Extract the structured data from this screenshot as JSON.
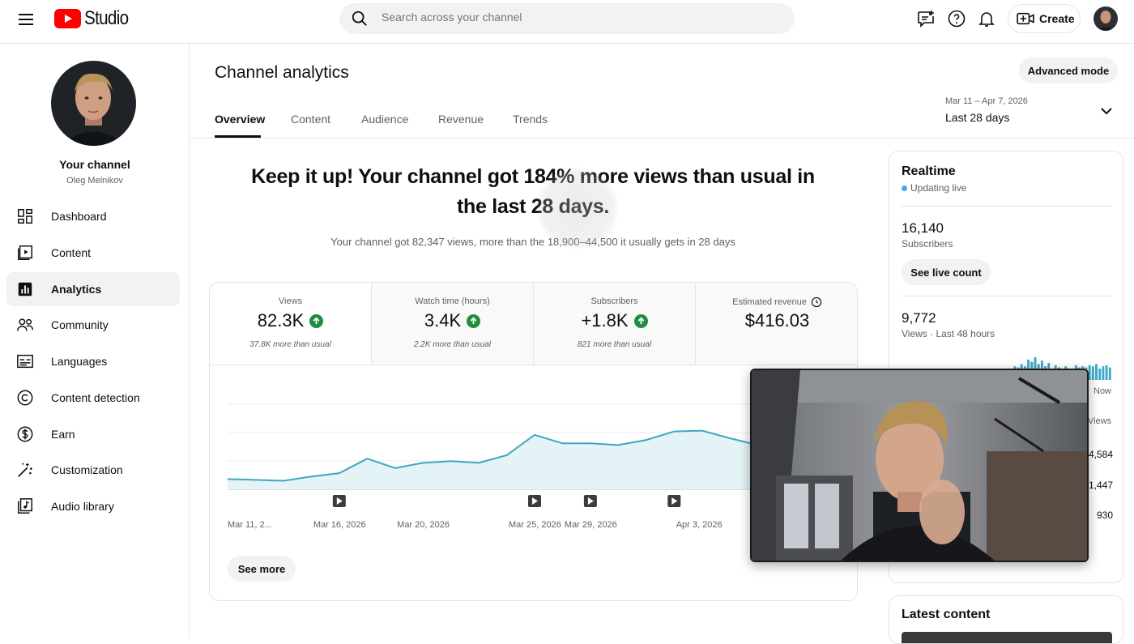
{
  "topbar": {
    "logo_text": "Studio",
    "search_placeholder": "Search across your channel",
    "create_label": "Create"
  },
  "sidebar": {
    "channel_name": "Your channel",
    "channel_handle": "Oleg Melnikov",
    "items": [
      {
        "label": "Dashboard",
        "icon": "dashboard-icon"
      },
      {
        "label": "Content",
        "icon": "content-icon"
      },
      {
        "label": "Analytics",
        "icon": "analytics-icon",
        "active": true
      },
      {
        "label": "Community",
        "icon": "community-icon"
      },
      {
        "label": "Languages",
        "icon": "languages-icon"
      },
      {
        "label": "Content detection",
        "icon": "copyright-icon"
      },
      {
        "label": "Earn",
        "icon": "dollar-icon"
      },
      {
        "label": "Customization",
        "icon": "magic-wand-icon"
      },
      {
        "label": "Audio library",
        "icon": "audio-library-icon"
      }
    ]
  },
  "main": {
    "title": "Channel analytics",
    "advanced_mode": "Advanced mode",
    "tabs": [
      "Overview",
      "Content",
      "Audience",
      "Revenue",
      "Trends"
    ],
    "active_tab": "Overview",
    "date_range": "Mar 11 – Apr 7, 2026",
    "date_label": "Last 28 days",
    "headline": "Keep it up! Your channel got 184% more views than usual in the last 28 days.",
    "subline": "Your channel got 82,347 views, more than the 18,900–44,500 it usually gets in 28 days",
    "see_more": "See more"
  },
  "metrics": [
    {
      "label": "Views",
      "value": "82.3K",
      "note": "37.8K more than usual",
      "trend": "up"
    },
    {
      "label": "Watch time (hours)",
      "value": "3.4K",
      "note": "2.2K more than usual",
      "trend": "up"
    },
    {
      "label": "Subscribers",
      "value": "+1.8K",
      "note": "821 more than usual",
      "trend": "up"
    },
    {
      "label": "Estimated revenue",
      "value": "$416.03",
      "note": "",
      "trend": "none",
      "icon": "clock-icon"
    }
  ],
  "chart_data": {
    "type": "area",
    "x_ticks": [
      "Mar 11, 2...",
      "Mar 16, 2026",
      "Mar 20, 2026",
      "Mar 25, 2026",
      "Mar 29, 2026",
      "Apr 3, 2026"
    ],
    "series": [
      {
        "values": [
          0.12,
          0.11,
          0.1,
          0.15,
          0.19,
          0.36,
          0.25,
          0.31,
          0.33,
          0.31,
          0.4,
          0.64,
          0.54,
          0.54,
          0.52,
          0.58,
          0.68,
          0.69,
          0.6,
          0.52,
          0.53,
          0.55,
          0.6
        ]
      }
    ],
    "video_markers": [
      4,
      11,
      13,
      16
    ],
    "grid": true,
    "color": "#3ea6c2"
  },
  "realtime": {
    "title": "Realtime",
    "status": "Updating live",
    "subscribers_value": "16,140",
    "subscribers_label": "Subscribers",
    "live_count_button": "See live count",
    "views_value": "9,772",
    "views_label": "Views · Last 48 hours",
    "now_label": "Now",
    "views_col": "Views",
    "rows": [
      "4,584",
      "1,447",
      "930"
    ],
    "bars": [
      0.3,
      0.4,
      0.3,
      0.35,
      0.3,
      0.4,
      0.35,
      0.3,
      0.4,
      0.35,
      0.3,
      0.35,
      0.3,
      0.25,
      0.3,
      0.35,
      0.3,
      0.4,
      0.3,
      0.35,
      0.3,
      0.25,
      0.3,
      0.35,
      0.3,
      0.2,
      0.2,
      0.25,
      0.3,
      0.35,
      0.3,
      0.4,
      0.5,
      0.6,
      0.55,
      0.7,
      0.6,
      0.9,
      0.8,
      1.0,
      0.7,
      0.85,
      0.6,
      0.75,
      0.5,
      0.65,
      0.55,
      0.5,
      0.6,
      0.45,
      0.5,
      0.65,
      0.55,
      0.6,
      0.55,
      0.65,
      0.6,
      0.7,
      0.5,
      0.6,
      0.65,
      0.55
    ]
  },
  "latest": {
    "title": "Latest content"
  }
}
